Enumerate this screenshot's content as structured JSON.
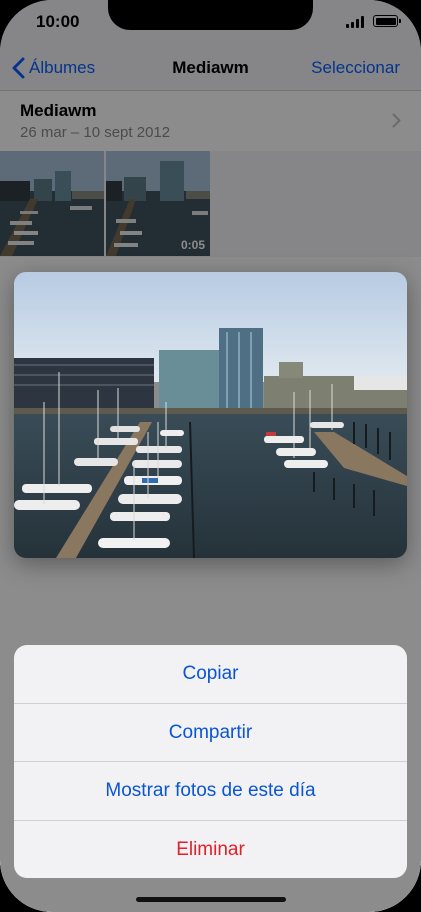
{
  "status_bar": {
    "time": "10:00",
    "signal_icon": "signal-bars-icon",
    "battery_icon": "battery-icon"
  },
  "nav": {
    "back_label": "Álbumes",
    "back_icon": "chevron-left-icon",
    "title": "Mediawm",
    "select_label": "Seleccionar"
  },
  "album": {
    "name": "Mediawm",
    "dates": "26 mar – 10 sept 2012",
    "chevron_icon": "chevron-right-icon"
  },
  "thumbnails": [
    {
      "kind": "photo"
    },
    {
      "kind": "video",
      "duration": "0:05"
    }
  ],
  "context_menu": {
    "items": [
      {
        "label": "Copiar",
        "style": "default"
      },
      {
        "label": "Compartir",
        "style": "default"
      },
      {
        "label": "Mostrar fotos de este día",
        "style": "default"
      },
      {
        "label": "Eliminar",
        "style": "destructive"
      }
    ]
  },
  "colors": {
    "accent": "#0a55d4",
    "destructive": "#e0202a"
  }
}
